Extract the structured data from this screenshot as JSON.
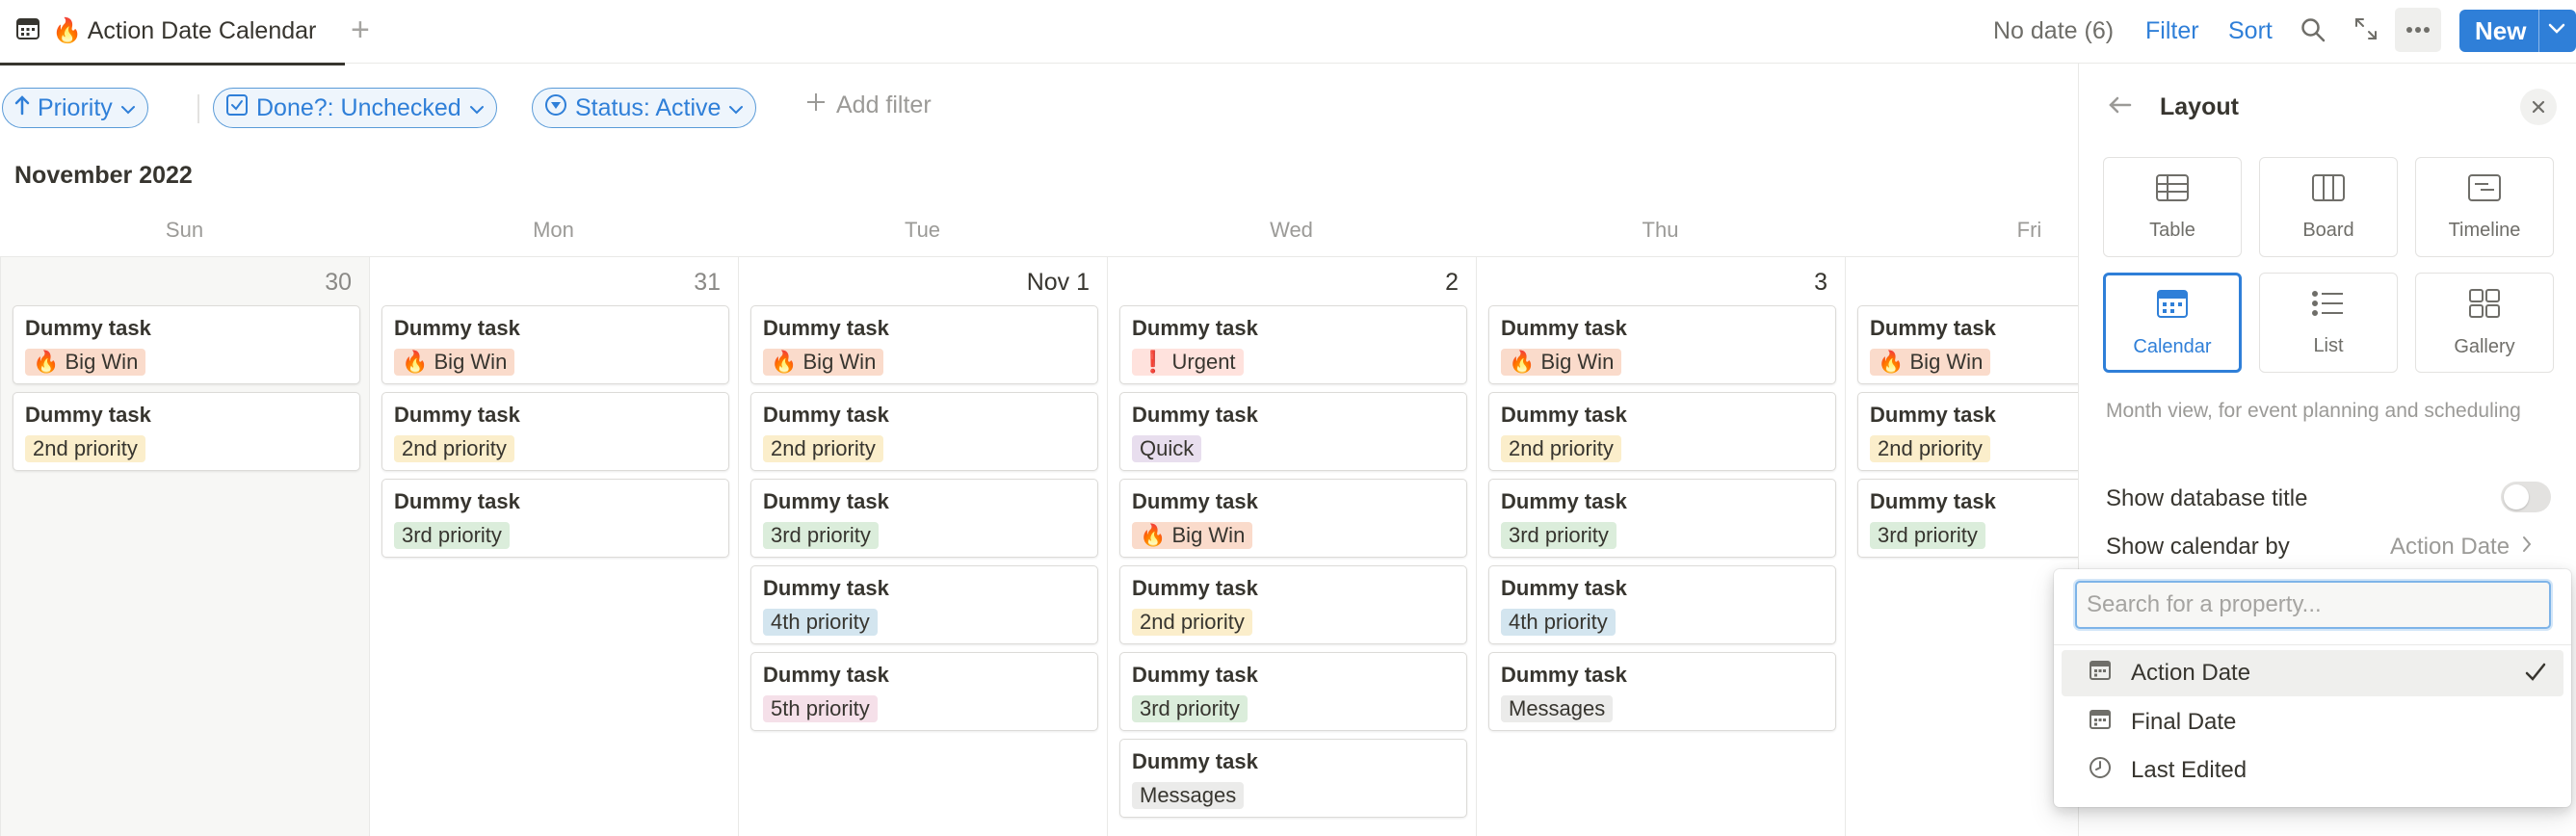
{
  "tab": {
    "icon": "calendar-icon",
    "emoji": "🔥",
    "title": "Action Date Calendar"
  },
  "toolbar": {
    "no_date": "No date (6)",
    "filter": "Filter",
    "sort": "Sort",
    "new": "New"
  },
  "filters": {
    "priority": "Priority",
    "done": "Done?: Unchecked",
    "status": "Status: Active",
    "add": "Add filter"
  },
  "calendar": {
    "month": "November 2022",
    "weekdays": [
      "Sun",
      "Mon",
      "Tue",
      "Wed",
      "Thu",
      "Fri"
    ],
    "days": [
      {
        "label": "30",
        "tasks": [
          {
            "title": "Dummy task",
            "tag": "🔥 Big Win",
            "color": "#fadbcb"
          },
          {
            "title": "Dummy task",
            "tag": "2nd priority",
            "color": "#fbeecb"
          }
        ]
      },
      {
        "label": "31",
        "tasks": [
          {
            "title": "Dummy task",
            "tag": "🔥 Big Win",
            "color": "#fadbcb"
          },
          {
            "title": "Dummy task",
            "tag": "2nd priority",
            "color": "#fbeecb"
          },
          {
            "title": "Dummy task",
            "tag": "3rd priority",
            "color": "#dbeddb"
          }
        ]
      },
      {
        "label": "Nov 1",
        "tasks": [
          {
            "title": "Dummy task",
            "tag": "🔥 Big Win",
            "color": "#fadbcb"
          },
          {
            "title": "Dummy task",
            "tag": "2nd priority",
            "color": "#fbeecb"
          },
          {
            "title": "Dummy task",
            "tag": "3rd priority",
            "color": "#dbeddb"
          },
          {
            "title": "Dummy task",
            "tag": "4th priority",
            "color": "#d3e5ef"
          },
          {
            "title": "Dummy task",
            "tag": "5th priority",
            "color": "#f5e0e9"
          }
        ]
      },
      {
        "label": "2",
        "tasks": [
          {
            "title": "Dummy task",
            "tag": "❗ Urgent",
            "color": "#ffe2dd"
          },
          {
            "title": "Dummy task",
            "tag": "Quick",
            "color": "#e8deee"
          },
          {
            "title": "Dummy task",
            "tag": "🔥 Big Win",
            "color": "#fadbcb"
          },
          {
            "title": "Dummy task",
            "tag": "2nd priority",
            "color": "#fbeecb"
          },
          {
            "title": "Dummy task",
            "tag": "3rd priority",
            "color": "#dbeddb"
          },
          {
            "title": "Dummy task",
            "tag": "Messages",
            "color": "#ebebea"
          }
        ]
      },
      {
        "label": "3",
        "tasks": [
          {
            "title": "Dummy task",
            "tag": "🔥 Big Win",
            "color": "#fadbcb"
          },
          {
            "title": "Dummy task",
            "tag": "2nd priority",
            "color": "#fbeecb"
          },
          {
            "title": "Dummy task",
            "tag": "3rd priority",
            "color": "#dbeddb"
          },
          {
            "title": "Dummy task",
            "tag": "4th priority",
            "color": "#d3e5ef"
          },
          {
            "title": "Dummy task",
            "tag": "Messages",
            "color": "#ebebea"
          }
        ]
      },
      {
        "label": "",
        "tasks": [
          {
            "title": "Dummy task",
            "tag": "🔥 Big Win",
            "color": "#fadbcb"
          },
          {
            "title": "Dummy task",
            "tag": "2nd priority",
            "color": "#fbeecb"
          },
          {
            "title": "Dummy task",
            "tag": "3rd priority",
            "color": "#dbeddb"
          }
        ]
      }
    ]
  },
  "panel": {
    "title": "Layout",
    "layouts": [
      {
        "label": "Table",
        "icon": "table-icon",
        "selected": false
      },
      {
        "label": "Board",
        "icon": "board-icon",
        "selected": false
      },
      {
        "label": "Timeline",
        "icon": "timeline-icon",
        "selected": false
      },
      {
        "label": "Calendar",
        "icon": "calendar-icon",
        "selected": true
      },
      {
        "label": "List",
        "icon": "list-icon",
        "selected": false
      },
      {
        "label": "Gallery",
        "icon": "gallery-icon",
        "selected": false
      }
    ],
    "description": "Month view, for event planning and scheduling",
    "show_title_label": "Show database title",
    "show_title_on": false,
    "show_by_label": "Show calendar by",
    "show_by_value": "Action Date"
  },
  "dropdown": {
    "placeholder": "Search for a property...",
    "items": [
      {
        "label": "Action Date",
        "icon": "calendar-icon",
        "checked": true
      },
      {
        "label": "Final Date",
        "icon": "calendar-icon",
        "checked": false
      },
      {
        "label": "Last Edited",
        "icon": "clock-icon",
        "checked": false
      }
    ]
  },
  "colors": {
    "accent": "#2f7fd8",
    "text": "#37352f",
    "muted": "#9b9a97"
  }
}
